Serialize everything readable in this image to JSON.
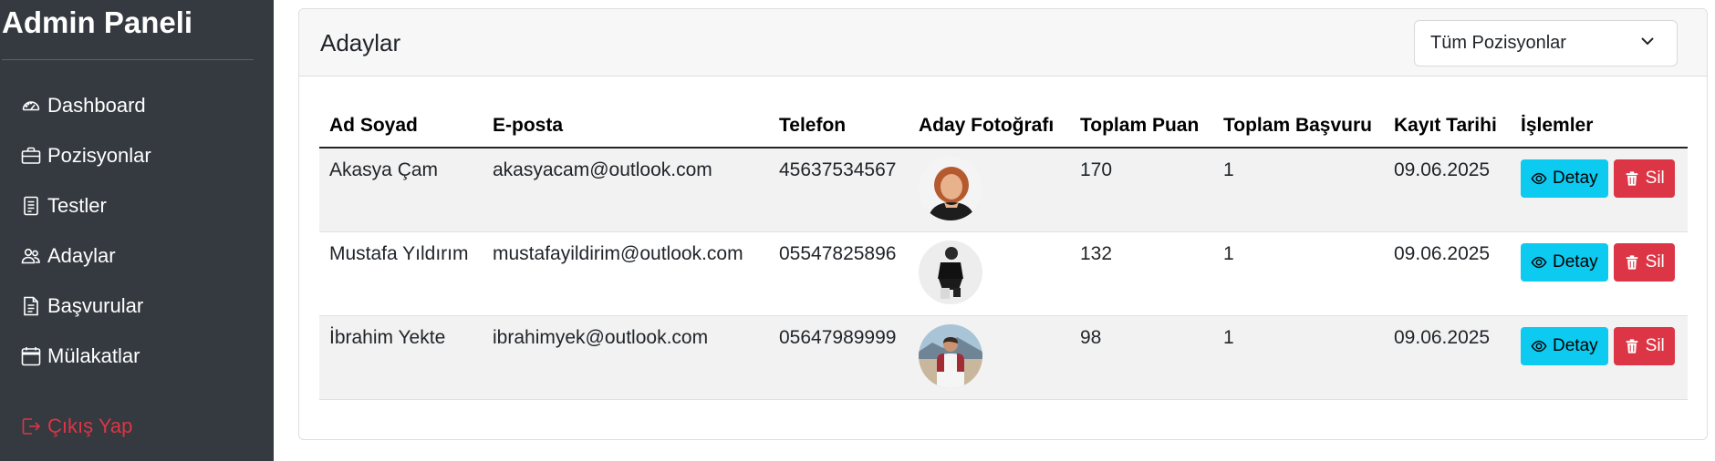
{
  "sidebar": {
    "brand": "Admin Paneli",
    "items": [
      {
        "label": "Dashboard",
        "icon": "speedometer-icon"
      },
      {
        "label": "Pozisyonlar",
        "icon": "briefcase-icon"
      },
      {
        "label": "Testler",
        "icon": "document-icon"
      },
      {
        "label": "Adaylar",
        "icon": "people-icon"
      },
      {
        "label": "Başvurular",
        "icon": "file-text-icon"
      },
      {
        "label": "Mülakatlar",
        "icon": "calendar-icon"
      }
    ],
    "logout": {
      "label": "Çıkış Yap",
      "icon": "logout-icon"
    }
  },
  "main": {
    "title": "Adaylar",
    "filter": {
      "selected": "Tüm Pozisyonlar",
      "icon": "chevron-down-icon"
    },
    "table": {
      "columns": [
        "Ad Soyad",
        "E-posta",
        "Telefon",
        "Aday Fotoğrafı",
        "Toplam Puan",
        "Toplam Başvuru",
        "Kayıt Tarihi",
        "İşlemler"
      ],
      "rows": [
        {
          "name": "Akasya Çam",
          "email": "akasyacam@outlook.com",
          "phone": "45637534567",
          "score": "170",
          "applications": "1",
          "date": "09.06.2025"
        },
        {
          "name": "Mustafa Yıldırım",
          "email": "mustafayildirim@outlook.com",
          "phone": "05547825896",
          "score": "132",
          "applications": "1",
          "date": "09.06.2025"
        },
        {
          "name": "İbrahim Yekte",
          "email": "ibrahimyek@outlook.com",
          "phone": "05647989999",
          "score": "98",
          "applications": "1",
          "date": "09.06.2025"
        }
      ],
      "detail_label": "Detay",
      "delete_label": "Sil"
    }
  },
  "colors": {
    "sidebar_bg": "#343a40",
    "danger": "#dc3545",
    "info": "#0dcaf0"
  }
}
